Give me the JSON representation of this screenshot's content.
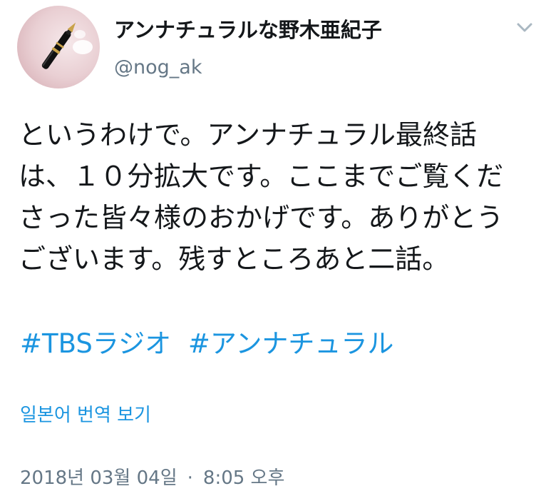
{
  "user": {
    "display_name": "アンナチュラルな野木亜紀子",
    "handle": "@nog_ak",
    "avatar_icon": "fountain-pen-avatar"
  },
  "tweet": {
    "lines": [
      "というわけで。アンナチュラル最終話",
      "は、１０分拡大です。ここまでご覧くだ",
      "さった皆々様のおかげです。ありがとう",
      "ございます。残すところあと二話。"
    ],
    "hashtags": [
      "#TBSラジオ",
      "#アンナチュラル"
    ]
  },
  "translate_label": "일본어 번역 보기",
  "timestamp": {
    "date": "2018년 03월 04일",
    "separator": "·",
    "time": "8:05 오후"
  },
  "menu_icon": "chevron-down-icon",
  "colors": {
    "link": "#1b95e0",
    "secondary": "#657786",
    "text": "#14171a"
  }
}
